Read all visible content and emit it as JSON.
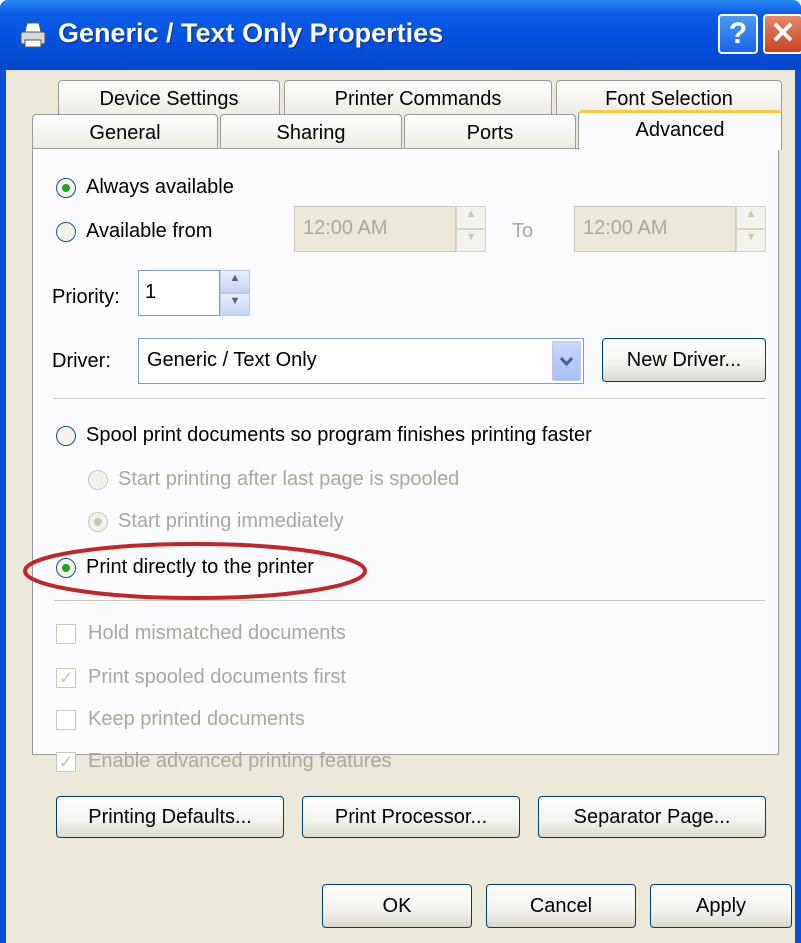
{
  "window": {
    "title": "Generic / Text Only Properties",
    "help_label": "?",
    "close_label": "✕"
  },
  "tabs": {
    "back_row": [
      "Device Settings",
      "Printer Commands",
      "Font Selection"
    ],
    "front_row": [
      "General",
      "Sharing",
      "Ports",
      "Advanced"
    ],
    "active": "Advanced"
  },
  "availability": {
    "always_label": "Always available",
    "from_label": "Available from",
    "from_time": "12:00 AM",
    "to_label": "To",
    "to_time": "12:00 AM",
    "selected": "always"
  },
  "priority": {
    "label": "Priority:",
    "value": "1"
  },
  "driver": {
    "label": "Driver:",
    "value": "Generic / Text Only",
    "new_button": "New Driver..."
  },
  "spool": {
    "spool_label": "Spool print documents so program finishes printing faster",
    "after_last_label": "Start printing after last page is spooled",
    "immediately_label": "Start printing immediately",
    "direct_label": "Print directly to the printer",
    "selected": "direct"
  },
  "options": [
    {
      "label": "Hold mismatched documents",
      "checked": false
    },
    {
      "label": "Print spooled documents first",
      "checked": true
    },
    {
      "label": "Keep printed documents",
      "checked": false
    },
    {
      "label": "Enable advanced printing features",
      "checked": true
    }
  ],
  "panel_buttons": {
    "defaults": "Printing Defaults...",
    "processor": "Print Processor...",
    "separator": "Separator Page..."
  },
  "dialog_buttons": {
    "ok": "OK",
    "cancel": "Cancel",
    "apply": "Apply"
  },
  "colors": {
    "title_bar": "#0551e0",
    "dialog_face": "#ece9d8",
    "highlight_ellipse": "#c0272d",
    "active_tab_accent": "#ffc73c"
  }
}
